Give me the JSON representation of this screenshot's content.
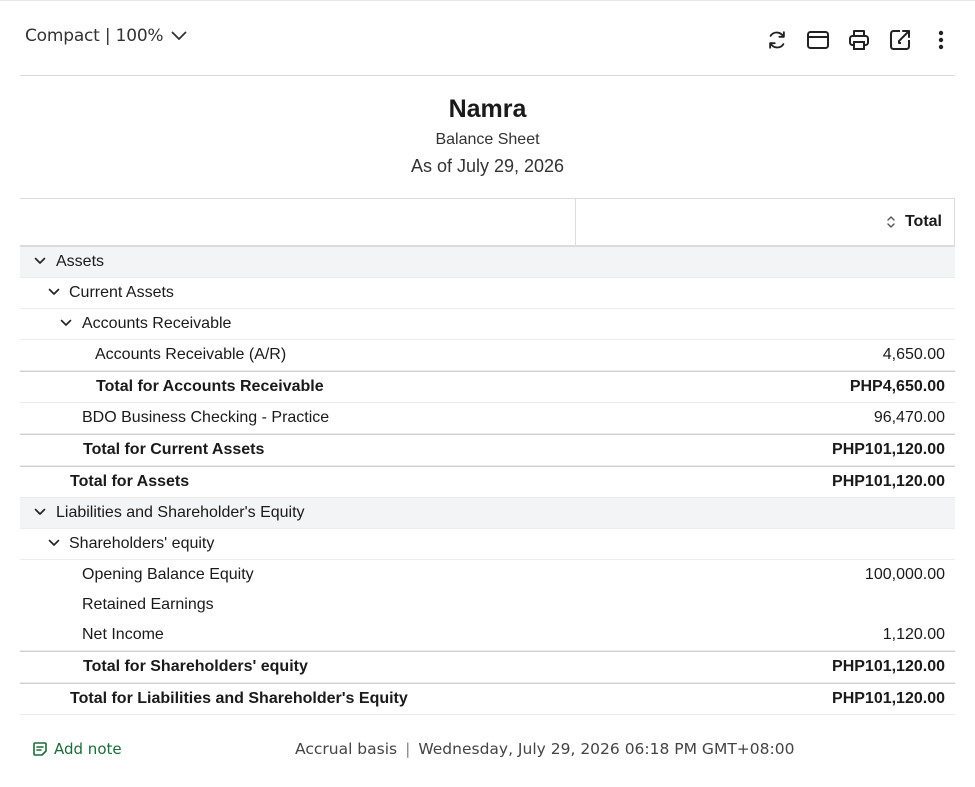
{
  "toolbar": {
    "view_label": "Compact | 100%",
    "icons": [
      "refresh-icon",
      "email-icon",
      "print-icon",
      "export-icon",
      "more-icon"
    ]
  },
  "header": {
    "company": "Namra",
    "report_title": "Balance Sheet",
    "as_of": "As of July 29, 2026"
  },
  "table": {
    "column_header": "Total",
    "rows": {
      "assets": "Assets",
      "current_assets": "Current Assets",
      "accounts_receivable": "Accounts Receivable",
      "ar_item": {
        "label": "Accounts Receivable (A/R)",
        "value": "4,650.00"
      },
      "total_ar": {
        "label": "Total for Accounts Receivable",
        "value": "PHP4,650.00"
      },
      "bdo": {
        "label": "BDO Business Checking - Practice",
        "value": "96,470.00"
      },
      "total_current_assets": {
        "label": "Total for Current Assets",
        "value": "PHP101,120.00"
      },
      "total_assets": {
        "label": "Total for Assets",
        "value": "PHP101,120.00"
      },
      "liab_equity": "Liabilities and Shareholder's Equity",
      "shareholders_equity": "Shareholders' equity",
      "opening_balance": {
        "label": "Opening Balance Equity",
        "value": "100,000.00"
      },
      "retained_earnings": {
        "label": "Retained Earnings",
        "value": ""
      },
      "net_income": {
        "label": "Net Income",
        "value": "1,120.00"
      },
      "total_shareholders_equity": {
        "label": "Total for Shareholders' equity",
        "value": "PHP101,120.00"
      },
      "total_liab_equity": {
        "label": "Total for Liabilities and Shareholder's Equity",
        "value": "PHP101,120.00"
      }
    }
  },
  "footer": {
    "add_note": "Add note",
    "basis": "Accrual basis",
    "timestamp": "Wednesday, July 29, 2026 06:18 PM GMT+08:00"
  },
  "colors": {
    "accent_green": "#1d6b3a",
    "section_bg": "#f3f4f6"
  }
}
